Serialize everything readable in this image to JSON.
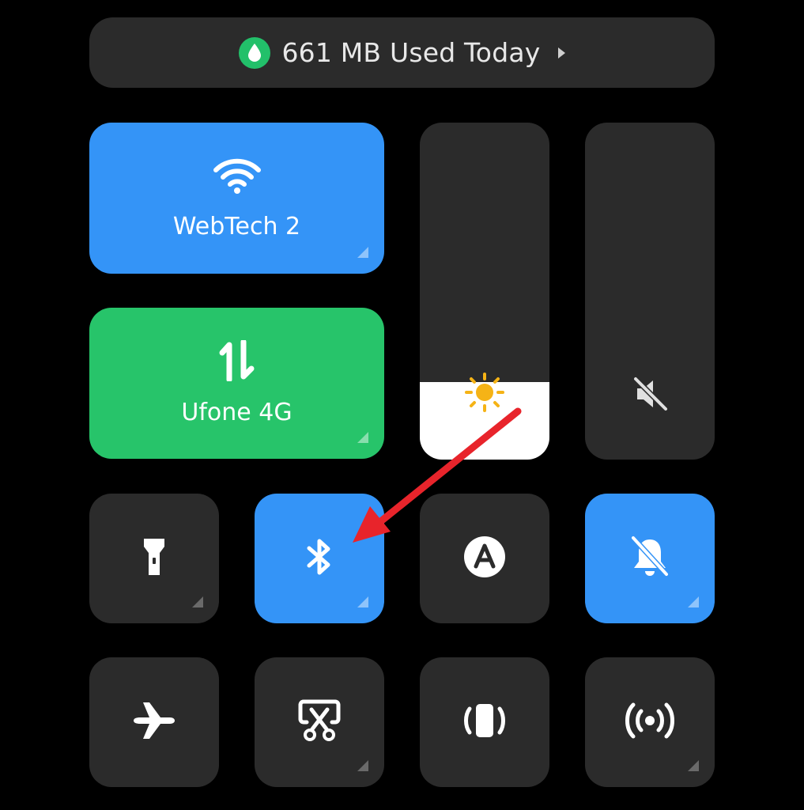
{
  "data_usage": {
    "label": "661 MB Used Today"
  },
  "wifi": {
    "label": "WebTech 2",
    "active": true,
    "color": "#3494f7"
  },
  "mobile_data": {
    "label": "Ufone 4G",
    "active": true,
    "color": "#27c46a"
  },
  "brightness": {
    "level_fraction": 0.23
  },
  "volume": {
    "muted": true
  },
  "toggles": [
    {
      "name": "flashlight",
      "icon": "flashlight-icon",
      "active": false
    },
    {
      "name": "bluetooth",
      "icon": "bluetooth-icon",
      "active": true
    },
    {
      "name": "auto-brightness",
      "icon": "auto-brightness-icon",
      "active": false
    },
    {
      "name": "do-not-disturb",
      "icon": "bell-off-icon",
      "active": true
    },
    {
      "name": "airplane-mode",
      "icon": "airplane-icon",
      "active": false
    },
    {
      "name": "screenshot",
      "icon": "scissors-screenshot-icon",
      "active": false
    },
    {
      "name": "vibrate",
      "icon": "vibrate-icon",
      "active": false
    },
    {
      "name": "hotspot",
      "icon": "hotspot-icon",
      "active": false
    }
  ],
  "annotation": {
    "type": "arrow",
    "color": "#e8242b",
    "points_to": "bluetooth"
  }
}
